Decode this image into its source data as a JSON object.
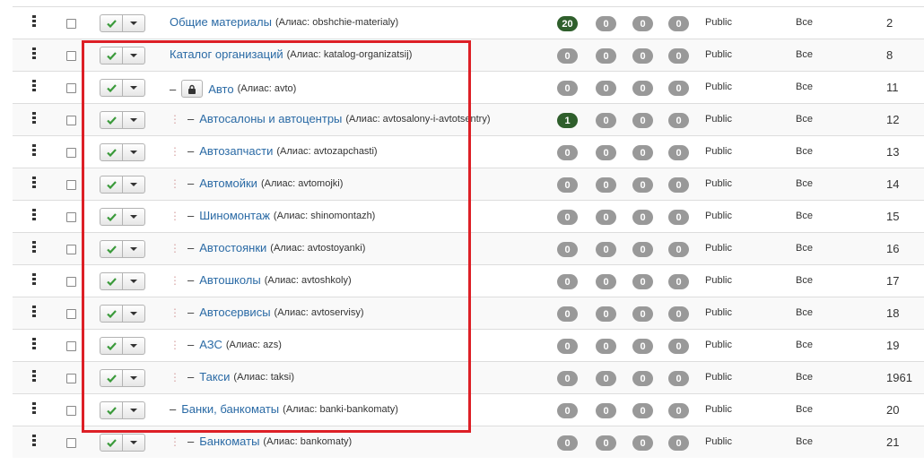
{
  "colors": {
    "highlight": "#dd1f26",
    "link": "#2a6aa5",
    "badge_gray": "#999999",
    "badge_green": "#2f5f2c",
    "publish_tick": "#3a9a3a"
  },
  "icons": {
    "drag": "drag-handle-icon",
    "publish": "check-icon",
    "dropdown": "caret-down-icon",
    "locked": "lock-icon"
  },
  "rows": [
    {
      "level": 1,
      "locked": false,
      "title": "Общие материалы",
      "alias": "(Алиас: obshchie-materialy)",
      "counts": [
        "20",
        "0",
        "0",
        "0"
      ],
      "access": "Public",
      "language": "Все",
      "id": "2"
    },
    {
      "level": 1,
      "locked": false,
      "title": "Каталог организаций",
      "alias": "(Алиас: katalog-organizatsij)",
      "counts": [
        "0",
        "0",
        "0",
        "0"
      ],
      "access": "Public",
      "language": "Все",
      "id": "8"
    },
    {
      "level": 2,
      "locked": true,
      "title": "Авто",
      "alias": "(Алиас: avto)",
      "counts": [
        "0",
        "0",
        "0",
        "0"
      ],
      "access": "Public",
      "language": "Все",
      "id": "11"
    },
    {
      "level": 3,
      "locked": false,
      "title": "Автосалоны и автоцентры",
      "alias": "(Алиас: avtosalony-i-avtotsentry)",
      "counts": [
        "1",
        "0",
        "0",
        "0"
      ],
      "access": "Public",
      "language": "Все",
      "id": "12"
    },
    {
      "level": 3,
      "locked": false,
      "title": "Автозапчасти",
      "alias": "(Алиас: avtozapchasti)",
      "counts": [
        "0",
        "0",
        "0",
        "0"
      ],
      "access": "Public",
      "language": "Все",
      "id": "13"
    },
    {
      "level": 3,
      "locked": false,
      "title": "Автомойки",
      "alias": "(Алиас: avtomojki)",
      "counts": [
        "0",
        "0",
        "0",
        "0"
      ],
      "access": "Public",
      "language": "Все",
      "id": "14"
    },
    {
      "level": 3,
      "locked": false,
      "title": "Шиномонтаж",
      "alias": "(Алиас: shinomontazh)",
      "counts": [
        "0",
        "0",
        "0",
        "0"
      ],
      "access": "Public",
      "language": "Все",
      "id": "15"
    },
    {
      "level": 3,
      "locked": false,
      "title": "Автостоянки",
      "alias": "(Алиас: avtostoyanki)",
      "counts": [
        "0",
        "0",
        "0",
        "0"
      ],
      "access": "Public",
      "language": "Все",
      "id": "16"
    },
    {
      "level": 3,
      "locked": false,
      "title": "Автошколы",
      "alias": "(Алиас: avtoshkoly)",
      "counts": [
        "0",
        "0",
        "0",
        "0"
      ],
      "access": "Public",
      "language": "Все",
      "id": "17"
    },
    {
      "level": 3,
      "locked": false,
      "title": "Автосервисы",
      "alias": "(Алиас: avtoservisy)",
      "counts": [
        "0",
        "0",
        "0",
        "0"
      ],
      "access": "Public",
      "language": "Все",
      "id": "18"
    },
    {
      "level": 3,
      "locked": false,
      "title": "АЗС",
      "alias": "(Алиас: azs)",
      "counts": [
        "0",
        "0",
        "0",
        "0"
      ],
      "access": "Public",
      "language": "Все",
      "id": "19"
    },
    {
      "level": 3,
      "locked": false,
      "title": "Такси",
      "alias": "(Алиас: taksi)",
      "counts": [
        "0",
        "0",
        "0",
        "0"
      ],
      "access": "Public",
      "language": "Все",
      "id": "1961"
    },
    {
      "level": 2,
      "locked": false,
      "title": "Банки, банкоматы",
      "alias": "(Алиас: banki-bankomaty)",
      "counts": [
        "0",
        "0",
        "0",
        "0"
      ],
      "access": "Public",
      "language": "Все",
      "id": "20"
    },
    {
      "level": 3,
      "locked": false,
      "title": "Банкоматы",
      "alias": "(Алиас: bankomaty)",
      "counts": [
        "0",
        "0",
        "0",
        "0"
      ],
      "access": "Public",
      "language": "Все",
      "id": "21"
    }
  ]
}
